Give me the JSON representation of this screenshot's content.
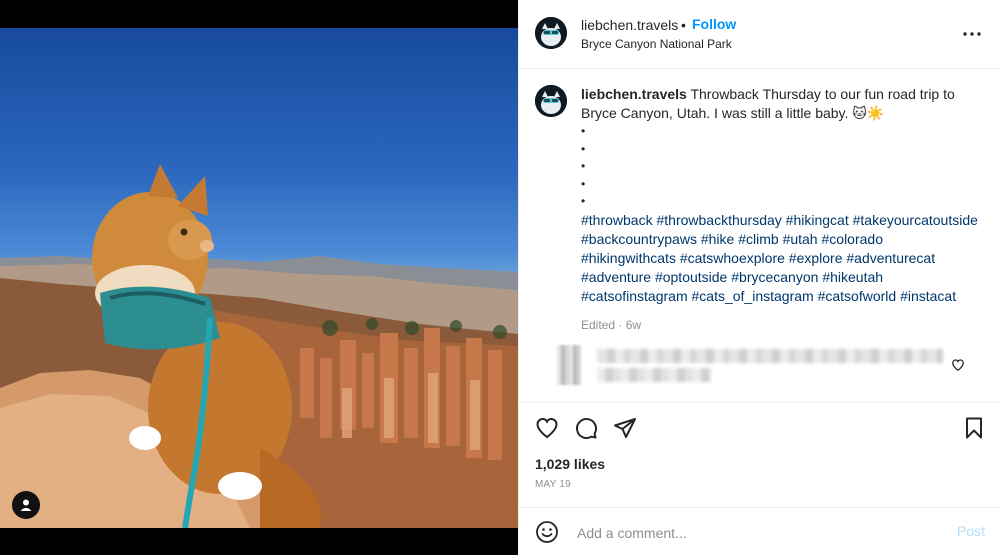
{
  "post": {
    "username": "liebchen.travels",
    "separator": "•",
    "follow_label": "Follow",
    "location": "Bryce Canyon National Park",
    "more_icon": "more-horizontal-icon"
  },
  "caption": {
    "username": "liebchen.travels",
    "text": " Throwback Thursday to our fun road trip to Bryce Canyon, Utah. I was still a little baby. 🐱☀️",
    "bullets": [
      "•",
      "•",
      "•",
      "•",
      "•"
    ],
    "hashtags": [
      "#throwback",
      "#throwbackthursday",
      "#hikingcat",
      "#takeyourcatoutside",
      "#backcountrypaws",
      "#hike",
      "#climb",
      "#utah",
      "#colorado",
      "#hikingwithcats",
      "#catswhoexplore",
      "#explore",
      "#adventurecat",
      "#adventure",
      "#optoutside",
      "#brycecanyon",
      "#hikeutah",
      "#catsofinstagram",
      "#cats_of_instagram",
      "#catsofworld",
      "#instacat"
    ],
    "edited": "Edited · 6w"
  },
  "engagement": {
    "likes": "1,029 likes",
    "date": "MAY 19"
  },
  "comment_box": {
    "placeholder": "Add a comment...",
    "post_label": "Post"
  },
  "colors": {
    "link_blue": "#0095f6",
    "hashtag": "#00376b",
    "muted": "#8e8e8e",
    "post_disabled": "#b2dffc"
  }
}
